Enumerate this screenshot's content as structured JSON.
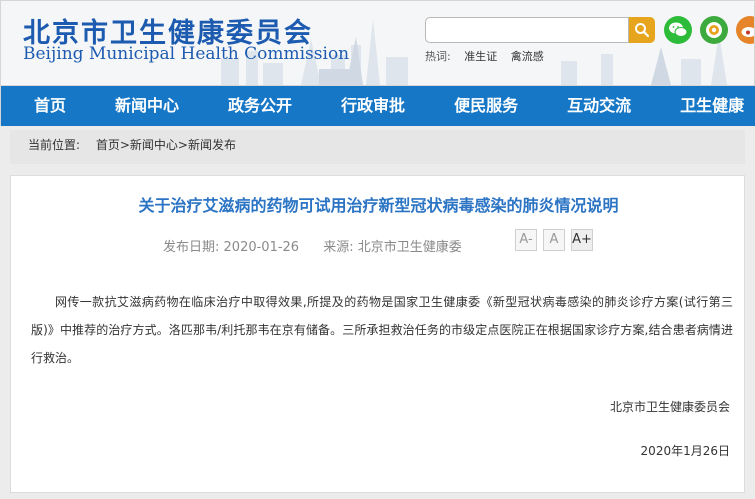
{
  "header": {
    "logo_cn": "北京市卫生健康委员会",
    "logo_en": "Beijing Municipal Health Commission",
    "search_placeholder": "",
    "hot_label": "热词:",
    "hot_words": [
      "准生证",
      "禽流感"
    ],
    "social_icons": [
      "wechat-icon",
      "app-icon",
      "weibo-icon"
    ]
  },
  "nav": {
    "items": [
      "首页",
      "新闻中心",
      "政务公开",
      "行政审批",
      "便民服务",
      "互动交流",
      "卫生健康"
    ]
  },
  "breadcrumb": {
    "label": "当前位置:",
    "path": "首页>新闻中心>新闻发布"
  },
  "article": {
    "title": "关于治疗艾滋病的药物可试用治疗新型冠状病毒感染的肺炎情况说明",
    "date_label": "发布日期:",
    "date": "2020-01-26",
    "source_label": "来源:",
    "source": "北京市卫生健康委",
    "font_buttons": [
      "A-",
      "A",
      "A+"
    ],
    "body": "网传一款抗艾滋病药物在临床治疗中取得效果,所提及的药物是国家卫生健康委《新型冠状病毒感染的肺炎诊疗方案(试行第三版)》中推荐的治疗方式。洛匹那韦/利托那韦在京有储备。三所承担救治任务的市级定点医院正在根据国家诊疗方案,结合患者病情进行救治。",
    "signature": "北京市卫生健康委员会",
    "sign_date": "2020年1月26日"
  },
  "colors": {
    "brand_blue": "#1c5bb0",
    "nav_blue": "#1677c7",
    "title_blue": "#2b74c4",
    "search_orange": "#e7a51e",
    "wechat_green": "#2dbb3a",
    "app_green": "#3caa3c",
    "weibo_orange": "#e6842a"
  }
}
